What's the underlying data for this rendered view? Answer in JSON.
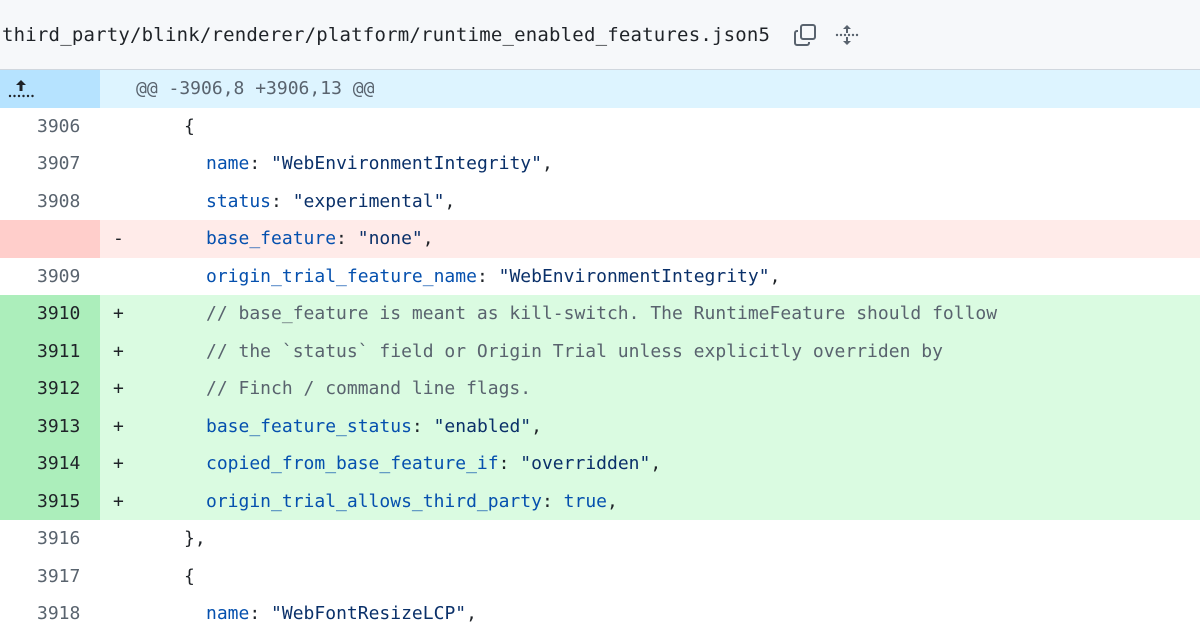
{
  "header": {
    "file_path": "third_party/blink/renderer/platform/runtime_enabled_features.json5",
    "copy_icon": "copy-icon",
    "expand_icon": "expand-all-icon"
  },
  "hunk": {
    "header": "@@ -3906,8 +3906,13 @@",
    "expand_icon": "expand-up-icon"
  },
  "lines": [
    {
      "type": "ctx",
      "num": "3906",
      "sign": "",
      "indent": 1,
      "parts": [
        {
          "t": "punct",
          "v": "{"
        }
      ]
    },
    {
      "type": "ctx",
      "num": "3907",
      "sign": "",
      "indent": 2,
      "parts": [
        {
          "t": "key",
          "v": "name"
        },
        {
          "t": "punct",
          "v": ": "
        },
        {
          "t": "str",
          "v": "\"WebEnvironmentIntegrity\""
        },
        {
          "t": "punct",
          "v": ","
        }
      ]
    },
    {
      "type": "ctx",
      "num": "3908",
      "sign": "",
      "indent": 2,
      "parts": [
        {
          "t": "key",
          "v": "status"
        },
        {
          "t": "punct",
          "v": ": "
        },
        {
          "t": "str",
          "v": "\"experimental\""
        },
        {
          "t": "punct",
          "v": ","
        }
      ]
    },
    {
      "type": "del",
      "num": "",
      "sign": "-",
      "indent": 2,
      "parts": [
        {
          "t": "key",
          "v": "base_feature"
        },
        {
          "t": "punct",
          "v": ": "
        },
        {
          "t": "str",
          "v": "\"none\""
        },
        {
          "t": "punct",
          "v": ","
        }
      ]
    },
    {
      "type": "ctx",
      "num": "3909",
      "sign": "",
      "indent": 2,
      "parts": [
        {
          "t": "key",
          "v": "origin_trial_feature_name"
        },
        {
          "t": "punct",
          "v": ": "
        },
        {
          "t": "str",
          "v": "\"WebEnvironmentIntegrity\""
        },
        {
          "t": "punct",
          "v": ","
        }
      ]
    },
    {
      "type": "add",
      "num": "3910",
      "sign": "+",
      "indent": 2,
      "parts": [
        {
          "t": "comment",
          "v": "// base_feature is meant as kill-switch. The RuntimeFeature should follow"
        }
      ]
    },
    {
      "type": "add",
      "num": "3911",
      "sign": "+",
      "indent": 2,
      "parts": [
        {
          "t": "comment",
          "v": "// the `status` field or Origin Trial unless explicitly overriden by"
        }
      ]
    },
    {
      "type": "add",
      "num": "3912",
      "sign": "+",
      "indent": 2,
      "parts": [
        {
          "t": "comment",
          "v": "// Finch / command line flags."
        }
      ]
    },
    {
      "type": "add",
      "num": "3913",
      "sign": "+",
      "indent": 2,
      "parts": [
        {
          "t": "key",
          "v": "base_feature_status"
        },
        {
          "t": "punct",
          "v": ": "
        },
        {
          "t": "str",
          "v": "\"enabled\""
        },
        {
          "t": "punct",
          "v": ","
        }
      ]
    },
    {
      "type": "add",
      "num": "3914",
      "sign": "+",
      "indent": 2,
      "parts": [
        {
          "t": "key",
          "v": "copied_from_base_feature_if"
        },
        {
          "t": "punct",
          "v": ": "
        },
        {
          "t": "str",
          "v": "\"overridden\""
        },
        {
          "t": "punct",
          "v": ","
        }
      ]
    },
    {
      "type": "add",
      "num": "3915",
      "sign": "+",
      "indent": 2,
      "parts": [
        {
          "t": "key",
          "v": "origin_trial_allows_third_party"
        },
        {
          "t": "punct",
          "v": ": "
        },
        {
          "t": "kw",
          "v": "true"
        },
        {
          "t": "punct",
          "v": ","
        }
      ]
    },
    {
      "type": "ctx",
      "num": "3916",
      "sign": "",
      "indent": 1,
      "parts": [
        {
          "t": "punct",
          "v": "},"
        }
      ]
    },
    {
      "type": "ctx",
      "num": "3917",
      "sign": "",
      "indent": 1,
      "parts": [
        {
          "t": "punct",
          "v": "{"
        }
      ]
    },
    {
      "type": "ctx",
      "num": "3918",
      "sign": "",
      "indent": 2,
      "parts": [
        {
          "t": "key",
          "v": "name"
        },
        {
          "t": "punct",
          "v": ": "
        },
        {
          "t": "str",
          "v": "\"WebFontResizeLCP\""
        },
        {
          "t": "punct",
          "v": ","
        }
      ]
    }
  ],
  "colors": {
    "add_bg": "#dafbe1",
    "add_num_bg": "#aceebb",
    "del_bg": "#ffebe9",
    "del_num_bg": "#ffcecb",
    "hunk_bg": "#ddf4ff",
    "hunk_num_bg": "#b6e3ff"
  }
}
